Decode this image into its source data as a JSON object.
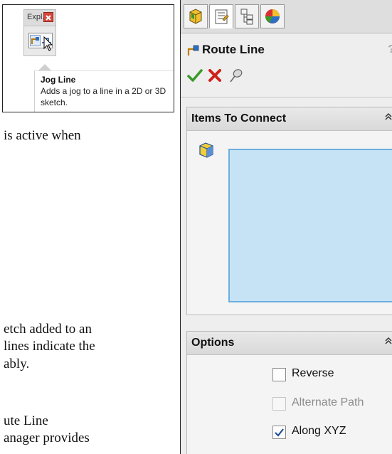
{
  "tooltip": {
    "toolbar_label": "Expl...",
    "title": "Jog Line",
    "description": "Adds a jog to a line in a 2D or 3D sketch."
  },
  "body_text": {
    "line1": "is active when",
    "line2": "etch added to an",
    "line3": "lines indicate the",
    "line4": "ably.",
    "line5": "ute Line",
    "line6": "anager provides"
  },
  "panel": {
    "tabs": [
      "featuremanager-icon",
      "propertymanager-icon",
      "configurationmanager-icon",
      "displaymanager-icon"
    ],
    "title": "Route Line",
    "help": "?",
    "actions": [
      "ok-checkmark-icon",
      "cancel-x-icon",
      "pushpin-icon"
    ],
    "groups": {
      "items_to_connect": {
        "title": "Items To Connect",
        "collapse": "»"
      },
      "options": {
        "title": "Options",
        "collapse": "»",
        "items": [
          {
            "label": "Reverse",
            "checked": false,
            "enabled": true
          },
          {
            "label": "Alternate Path",
            "checked": false,
            "enabled": false
          },
          {
            "label": "Along XYZ",
            "checked": true,
            "enabled": true
          }
        ]
      }
    }
  },
  "colors": {
    "selection_box": "#c6e3f5",
    "selection_border": "#6aaee0",
    "ok_green": "#3a9a2a",
    "cancel_red": "#d0201a"
  }
}
